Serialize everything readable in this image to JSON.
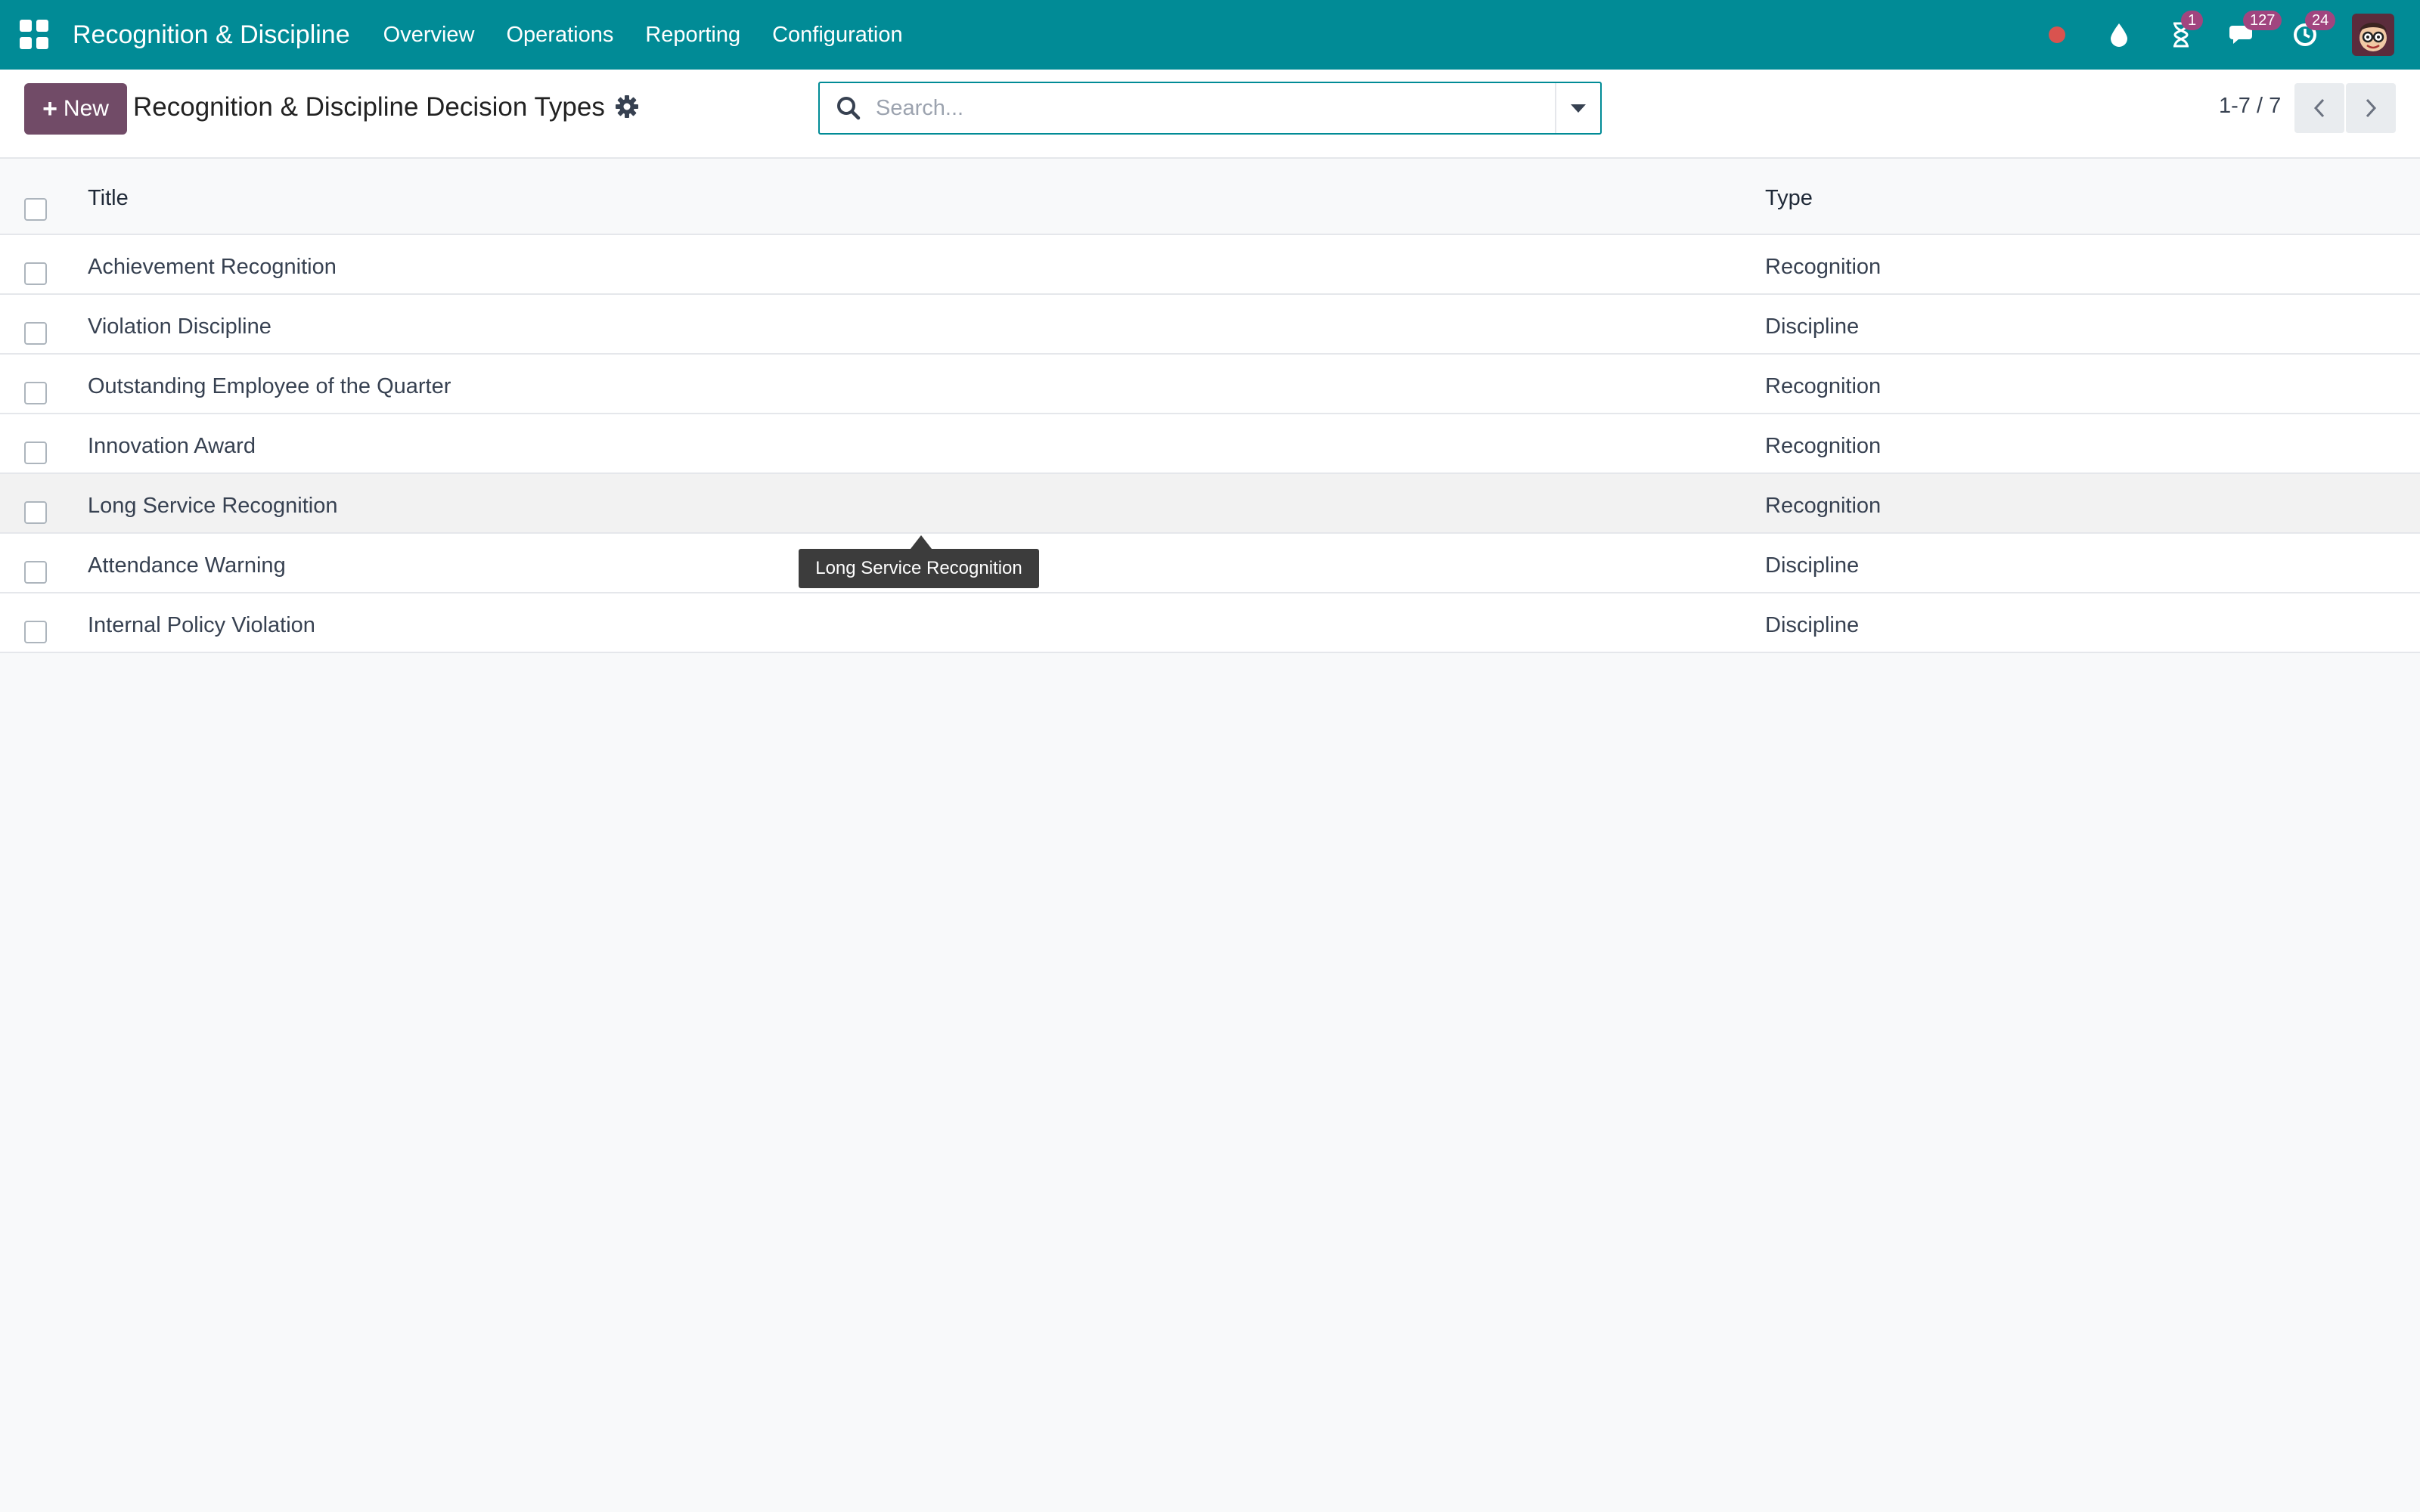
{
  "navbar": {
    "app_name": "Recognition & Discipline",
    "menu": [
      {
        "label": "Overview"
      },
      {
        "label": "Operations"
      },
      {
        "label": "Reporting"
      },
      {
        "label": "Configuration"
      }
    ],
    "icons": [
      "apps-icon",
      "record-dot-icon",
      "droplet-icon",
      "hourglass-icon",
      "chat-icon",
      "activity-clock-icon"
    ],
    "badges": {
      "activities": "1",
      "messages": "127",
      "reminders": "24"
    },
    "colors": {
      "primary": "#018b96",
      "badge": "#a1457f",
      "record_dot": "#d9534f"
    }
  },
  "control_panel": {
    "new_label": "New",
    "title": "Recognition & Discipline Decision Types",
    "search_placeholder": "Search...",
    "pager": "1-7 / 7",
    "colors": {
      "new_button": "#714b67"
    }
  },
  "table": {
    "columns": {
      "title": "Title",
      "type": "Type"
    },
    "rows": [
      {
        "title": "Achievement Recognition",
        "type": "Recognition"
      },
      {
        "title": "Violation Discipline",
        "type": "Discipline"
      },
      {
        "title": "Outstanding Employee of the Quarter",
        "type": "Recognition"
      },
      {
        "title": "Innovation Award",
        "type": "Recognition"
      },
      {
        "title": "Long Service Recognition",
        "type": "Recognition"
      },
      {
        "title": "Attendance Warning",
        "type": "Discipline"
      },
      {
        "title": "Internal Policy Violation",
        "type": "Discipline"
      }
    ]
  },
  "tooltip": {
    "text": "Long Service Recognition"
  }
}
